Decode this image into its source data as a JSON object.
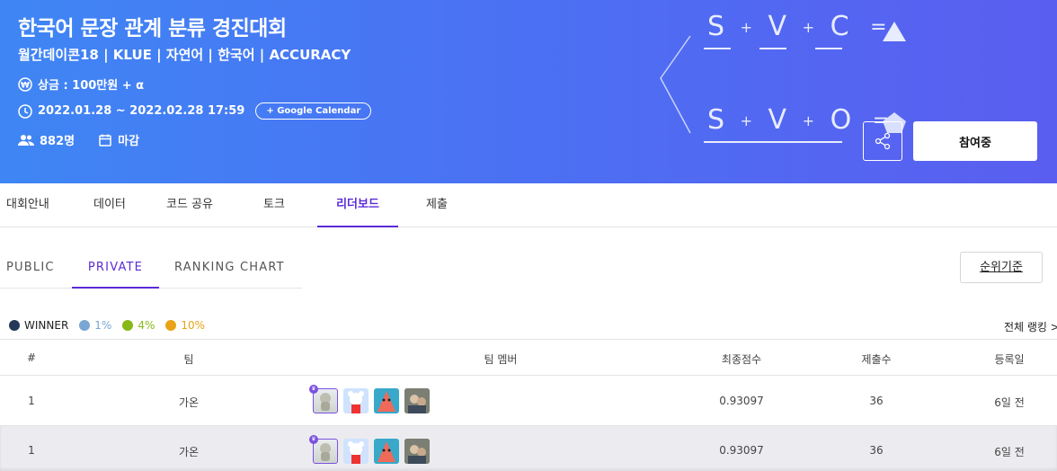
{
  "banner": {
    "title": "한국어 문장 관계 분류 경진대회",
    "subtitle": "월간데이콘18 | KLUE | 자연어 | 한국어 | ACCURACY",
    "prize": "상금 : 100만원 + α",
    "period": "2022.01.28 ~ 2022.02.28 17:59",
    "google_calendar": "+ Google Calendar",
    "participants": "882명",
    "status": "마감",
    "join_label": "참여중",
    "formula_line1": [
      "S",
      "+",
      "V",
      "+",
      "C",
      "="
    ],
    "formula_line2": [
      "S",
      "+",
      "V",
      "+",
      "O",
      "="
    ]
  },
  "tabs": [
    "대회안내",
    "데이터",
    "코드 공유",
    "토크",
    "리더보드",
    "제출"
  ],
  "active_tab": "리더보드",
  "subtabs": [
    "PUBLIC",
    "PRIVATE",
    "RANKING CHART"
  ],
  "active_subtab": "PRIVATE",
  "criteria_label": "순위기준",
  "legend": [
    {
      "label": "WINNER",
      "color": "#253858"
    },
    {
      "label": "1%",
      "color": "#7aa6d3"
    },
    {
      "label": "4%",
      "color": "#86b818"
    },
    {
      "label": "10%",
      "color": "#e8a317"
    }
  ],
  "all_ranking": "전체 랭킹 >",
  "table": {
    "headers": [
      "#",
      "팀",
      "팀 멤버",
      "최종점수",
      "제출수",
      "등록일"
    ],
    "rows": [
      {
        "rank": "1",
        "team": "가온",
        "score": "0.93097",
        "submissions": "36",
        "registered": "6일 전"
      },
      {
        "rank": "1",
        "team": "가온",
        "score": "0.93097",
        "submissions": "36",
        "registered": "6일 전"
      }
    ]
  },
  "colors": {
    "accent": "#5b2bd8",
    "banner_start": "#3f86f4",
    "banner_end": "#5a5ef0"
  }
}
